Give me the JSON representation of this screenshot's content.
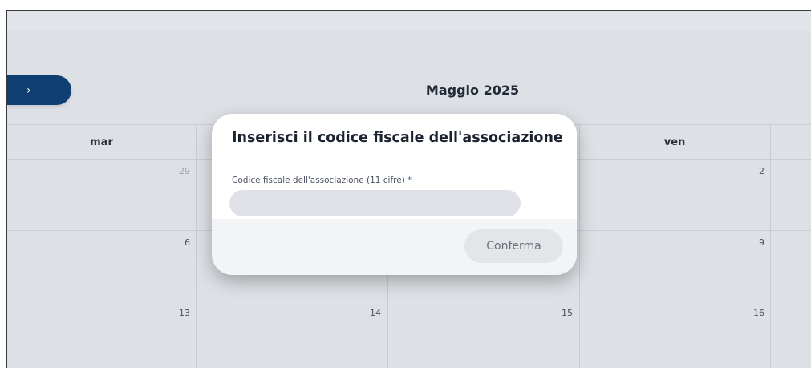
{
  "calendar": {
    "next_button_glyph": "›",
    "month_title": "Maggio 2025",
    "column_headers": [
      "mar",
      "",
      "",
      "ven",
      ""
    ],
    "weeks": [
      [
        "29",
        "",
        "",
        "2",
        ""
      ],
      [
        "6",
        "",
        "",
        "9",
        ""
      ],
      [
        "13",
        "14",
        "15",
        "16",
        ""
      ]
    ]
  },
  "modal": {
    "title": "Inserisci il codice fiscale dell'associazione",
    "field_label": "Codice fiscale dell'associazione (11 cifre)",
    "required_marker": "*",
    "field_value": "",
    "field_placeholder": "",
    "confirm_label": "Conferma"
  }
}
